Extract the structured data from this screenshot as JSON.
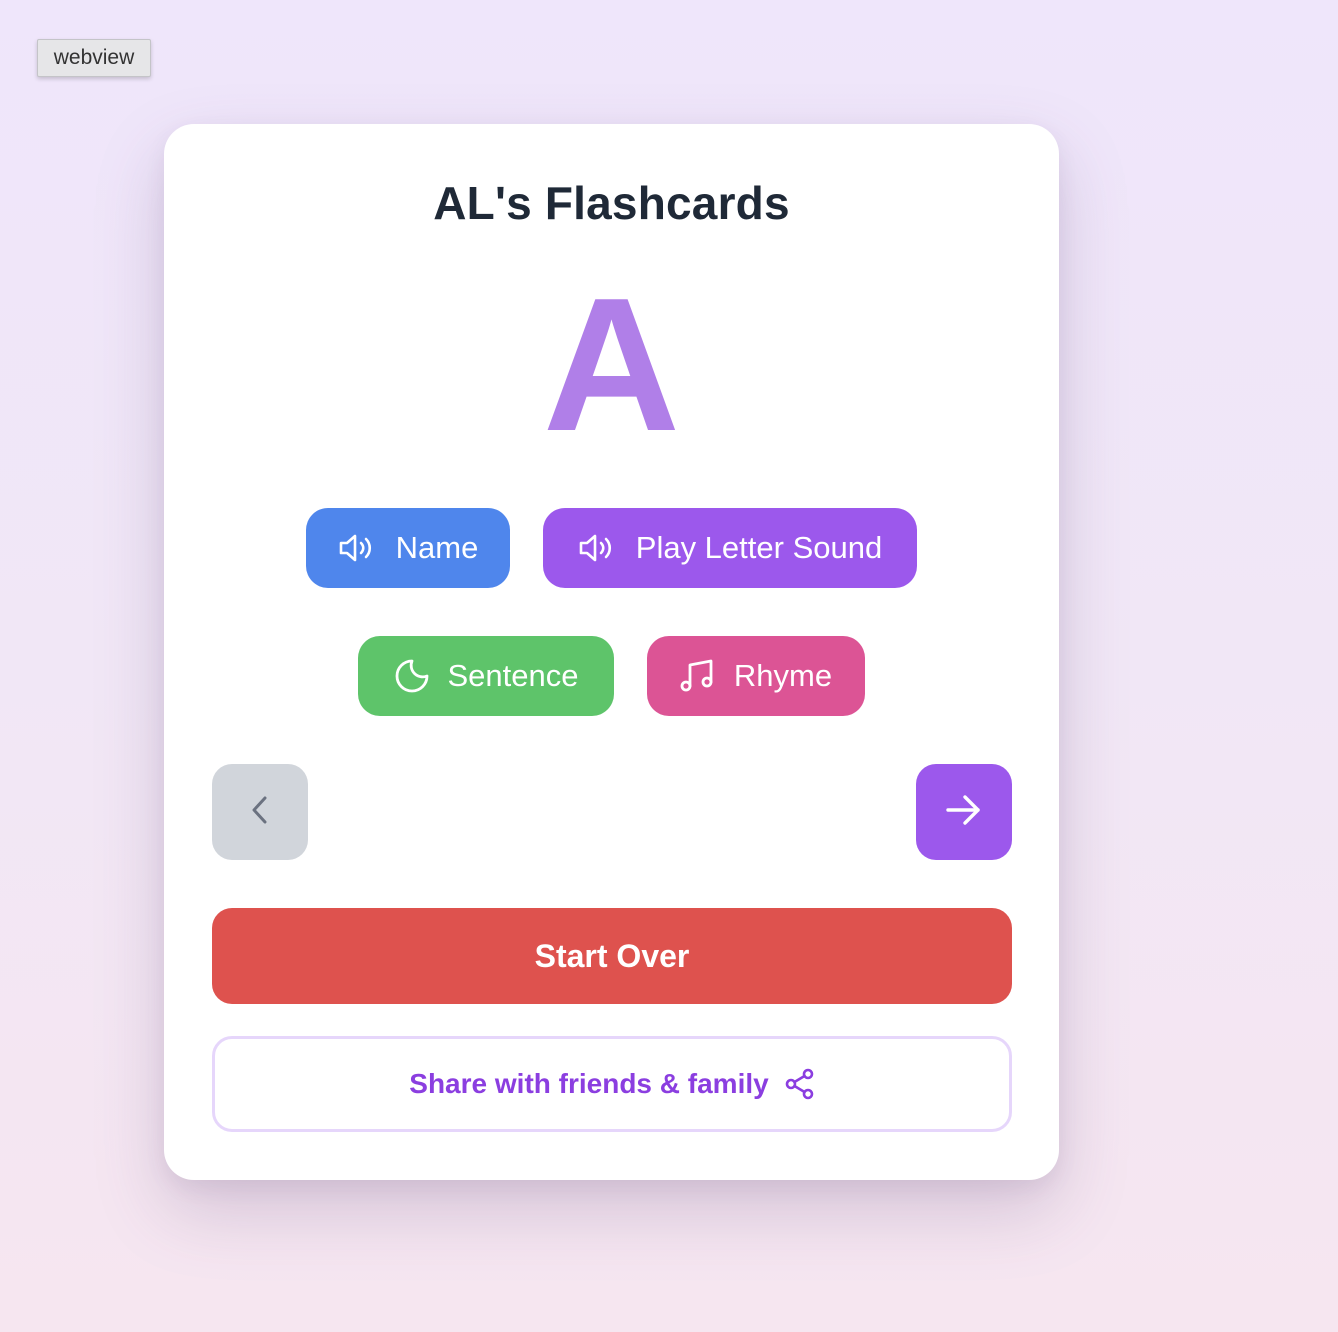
{
  "webview_label": "webview",
  "card": {
    "title": "AL's Flashcards",
    "letter": "A",
    "buttons": {
      "name": "Name",
      "play_sound": "Play Letter Sound",
      "sentence": "Sentence",
      "rhyme": "Rhyme"
    },
    "start_over": "Start Over",
    "share": "Share with friends & family"
  },
  "icons": {
    "name": "speaker-icon",
    "play_sound": "speaker-icon",
    "sentence": "moon-icon",
    "rhyme": "music-note-icon",
    "prev": "chevron-left-icon",
    "next": "arrow-right-icon",
    "share": "share-icon"
  },
  "colors": {
    "letter": "#b07fe8",
    "name_button": "#4f86ec",
    "sound_button": "#9c58ec",
    "sentence_button": "#5ec46a",
    "rhyme_button": "#dc5495",
    "prev_button": "#d1d5db",
    "next_button": "#9c58ec",
    "start_over_button": "#de524e",
    "share_text": "#8b3ee0"
  }
}
